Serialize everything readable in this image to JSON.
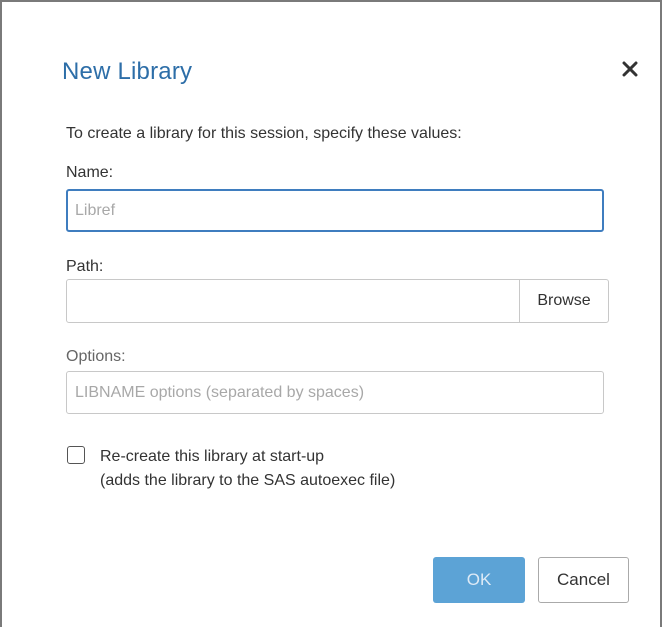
{
  "dialog": {
    "title": "New Library",
    "instructions": "To create a library for this session, specify these values:",
    "close_icon": "close-icon"
  },
  "fields": {
    "name": {
      "label": "Name:",
      "value": "",
      "placeholder": "Libref"
    },
    "path": {
      "label": "Path:",
      "value": "",
      "placeholder": "",
      "browse_label": "Browse"
    },
    "options": {
      "label": "Options:",
      "value": "",
      "placeholder": "LIBNAME options (separated by spaces)"
    }
  },
  "recreate": {
    "checked": false,
    "label_line1": "Re-create this library at start-up",
    "label_line2": "(adds the library to the SAS autoexec file)"
  },
  "buttons": {
    "ok_label": "OK",
    "cancel_label": "Cancel"
  },
  "colors": {
    "title": "#2d6ea8",
    "focus_border": "#3f7dbf",
    "primary_button": "#5ca3d6"
  }
}
